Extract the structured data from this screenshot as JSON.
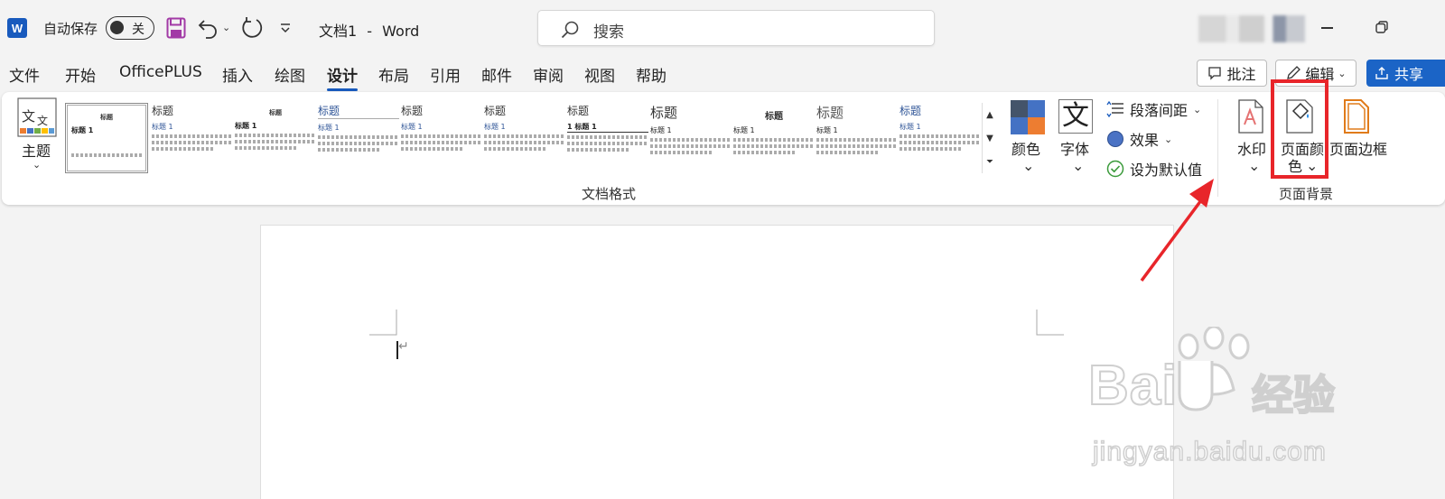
{
  "app": {
    "logo_letter": "W",
    "autosave_label": "自动保存",
    "autosave_state": "关",
    "doc_name": "文档1",
    "separator": "-",
    "app_name": "Word",
    "search_placeholder": "搜索"
  },
  "tabs": [
    {
      "label": "文件",
      "active": false
    },
    {
      "label": "开始",
      "active": false
    },
    {
      "label": "OfficePLUS",
      "active": false
    },
    {
      "label": "插入",
      "active": false
    },
    {
      "label": "绘图",
      "active": false
    },
    {
      "label": "设计",
      "active": true
    },
    {
      "label": "布局",
      "active": false
    },
    {
      "label": "引用",
      "active": false
    },
    {
      "label": "邮件",
      "active": false
    },
    {
      "label": "审阅",
      "active": false
    },
    {
      "label": "视图",
      "active": false
    },
    {
      "label": "帮助",
      "active": false
    }
  ],
  "actions": {
    "comment": "批注",
    "edit": "编辑",
    "share": "共享"
  },
  "ribbon": {
    "themes_label": "主题",
    "theme_icon_text": "文文",
    "gallery": [
      {
        "title": "标题",
        "subtitle": "标题 1"
      },
      {
        "title": "标题",
        "subtitle": "标题 1"
      },
      {
        "title": "标题",
        "subtitle": "标题 1"
      },
      {
        "title": "标题",
        "subtitle": "标题 1"
      },
      {
        "title": "标题",
        "subtitle": "标题 1"
      },
      {
        "title": "标题",
        "subtitle": "标题 1"
      },
      {
        "title": "标题",
        "subtitle": "1 标题 1"
      },
      {
        "title": "标题",
        "subtitle": "标题 1"
      },
      {
        "title": "标题",
        "subtitle": "标题 1"
      },
      {
        "title": "标题",
        "subtitle": "标题 1"
      },
      {
        "title": "标题",
        "subtitle": "标题 1"
      }
    ],
    "doc_format_group": "文档格式",
    "colors_label": "颜色",
    "fonts_label": "字体",
    "fonts_icon_text": "文",
    "paragraph_spacing": "段落间距",
    "effects": "效果",
    "set_default": "设为默认值",
    "watermark": "水印",
    "page_color_line1": "页面颜",
    "page_color_line2": "色",
    "page_borders": "页面边框",
    "page_background_group": "页面背景"
  },
  "watermark_site": {
    "brand": "Bai",
    "brand2": "经验",
    "url": "jingyan.baidu.com"
  },
  "colors": {
    "accent": "#185abd",
    "annotation": "#e8252a",
    "swatch": [
      "#44546a",
      "#4472c4",
      "#4472c4",
      "#ed7d31"
    ]
  }
}
